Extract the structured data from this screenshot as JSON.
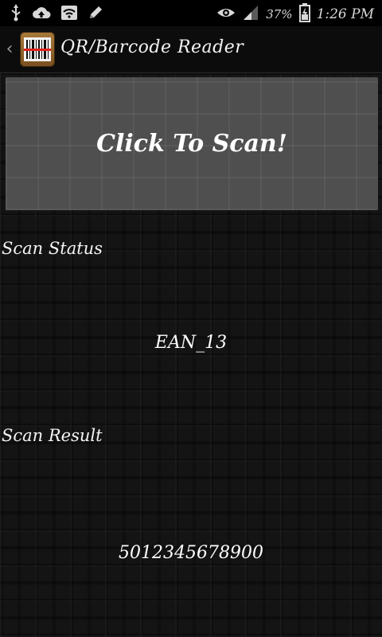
{
  "status_bar": {
    "icons": [
      "usb-icon",
      "cloud-upload-icon",
      "wifi-icon",
      "pencil-icon",
      "eye-icon",
      "signal-icon",
      "battery-icon"
    ],
    "battery_percent": "37%",
    "time": "1:26 PM"
  },
  "action_bar": {
    "title": "QR/Barcode Reader"
  },
  "scan_button": {
    "label": "Click To Scan!"
  },
  "scan_status": {
    "label": "Scan Status",
    "value": "EAN_13"
  },
  "scan_result": {
    "label": "Scan Result",
    "value": "5012345678900"
  },
  "colors": {
    "background": "#141414",
    "button": "#4f4f4f",
    "text": "#ffffff",
    "app_icon_frame": "#a97a3a",
    "app_icon_barcode_red": "#e0201a"
  }
}
